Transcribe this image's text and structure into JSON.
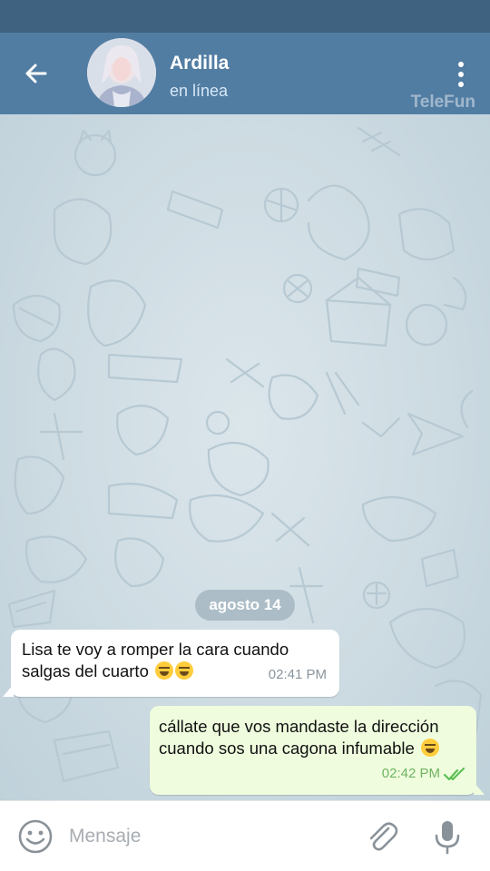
{
  "header": {
    "title": "Ardilla",
    "status": "en línea",
    "watermark": "TeleFun"
  },
  "chat": {
    "date_separator": "agosto 14",
    "messages": [
      {
        "direction": "incoming",
        "text": "Lisa te voy a romper la cara cuando salgas del cuarto",
        "emojis": [
          "rofl-emoji",
          "rofl-emoji"
        ],
        "time": "02:41 PM"
      },
      {
        "direction": "outgoing",
        "text": "cállate que vos mandaste la dirección cuando sos una cagona infumable",
        "emojis": [
          "pleading-emoji"
        ],
        "time": "02:42 PM",
        "read": true
      }
    ]
  },
  "input": {
    "placeholder": "Mensaje"
  },
  "colors": {
    "header": "#527da3",
    "status_bar": "#3f6280",
    "outgoing_bubble": "#effdde",
    "incoming_bubble": "#ffffff",
    "read_check": "#5ebf55"
  }
}
